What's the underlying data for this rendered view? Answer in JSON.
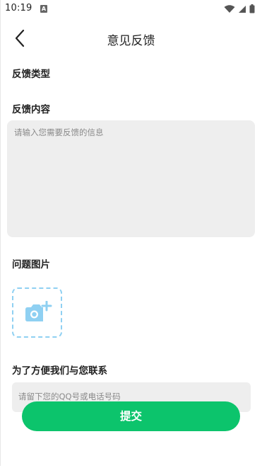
{
  "status_bar": {
    "time": "10:19",
    "notification_letter": "A",
    "icons": [
      "wifi-icon",
      "cell-signal-icon",
      "battery-icon"
    ]
  },
  "header": {
    "title": "意见反馈",
    "back_icon": "chevron-left-icon"
  },
  "form": {
    "type_label": "反馈类型",
    "content_label": "反馈内容",
    "content_placeholder": "请输入您需要反馈的信息",
    "image_label": "问题图片",
    "upload_icon": "camera-add-icon",
    "contact_label": "为了方便我们与您联系",
    "contact_placeholder": "请留下您的QQ号或电话号码"
  },
  "actions": {
    "submit_label": "提交"
  },
  "colors": {
    "accent": "#0cc46c",
    "upload_blue": "#8fd0f2",
    "input_bg": "#eeeeee",
    "placeholder": "#8a8a8a"
  }
}
